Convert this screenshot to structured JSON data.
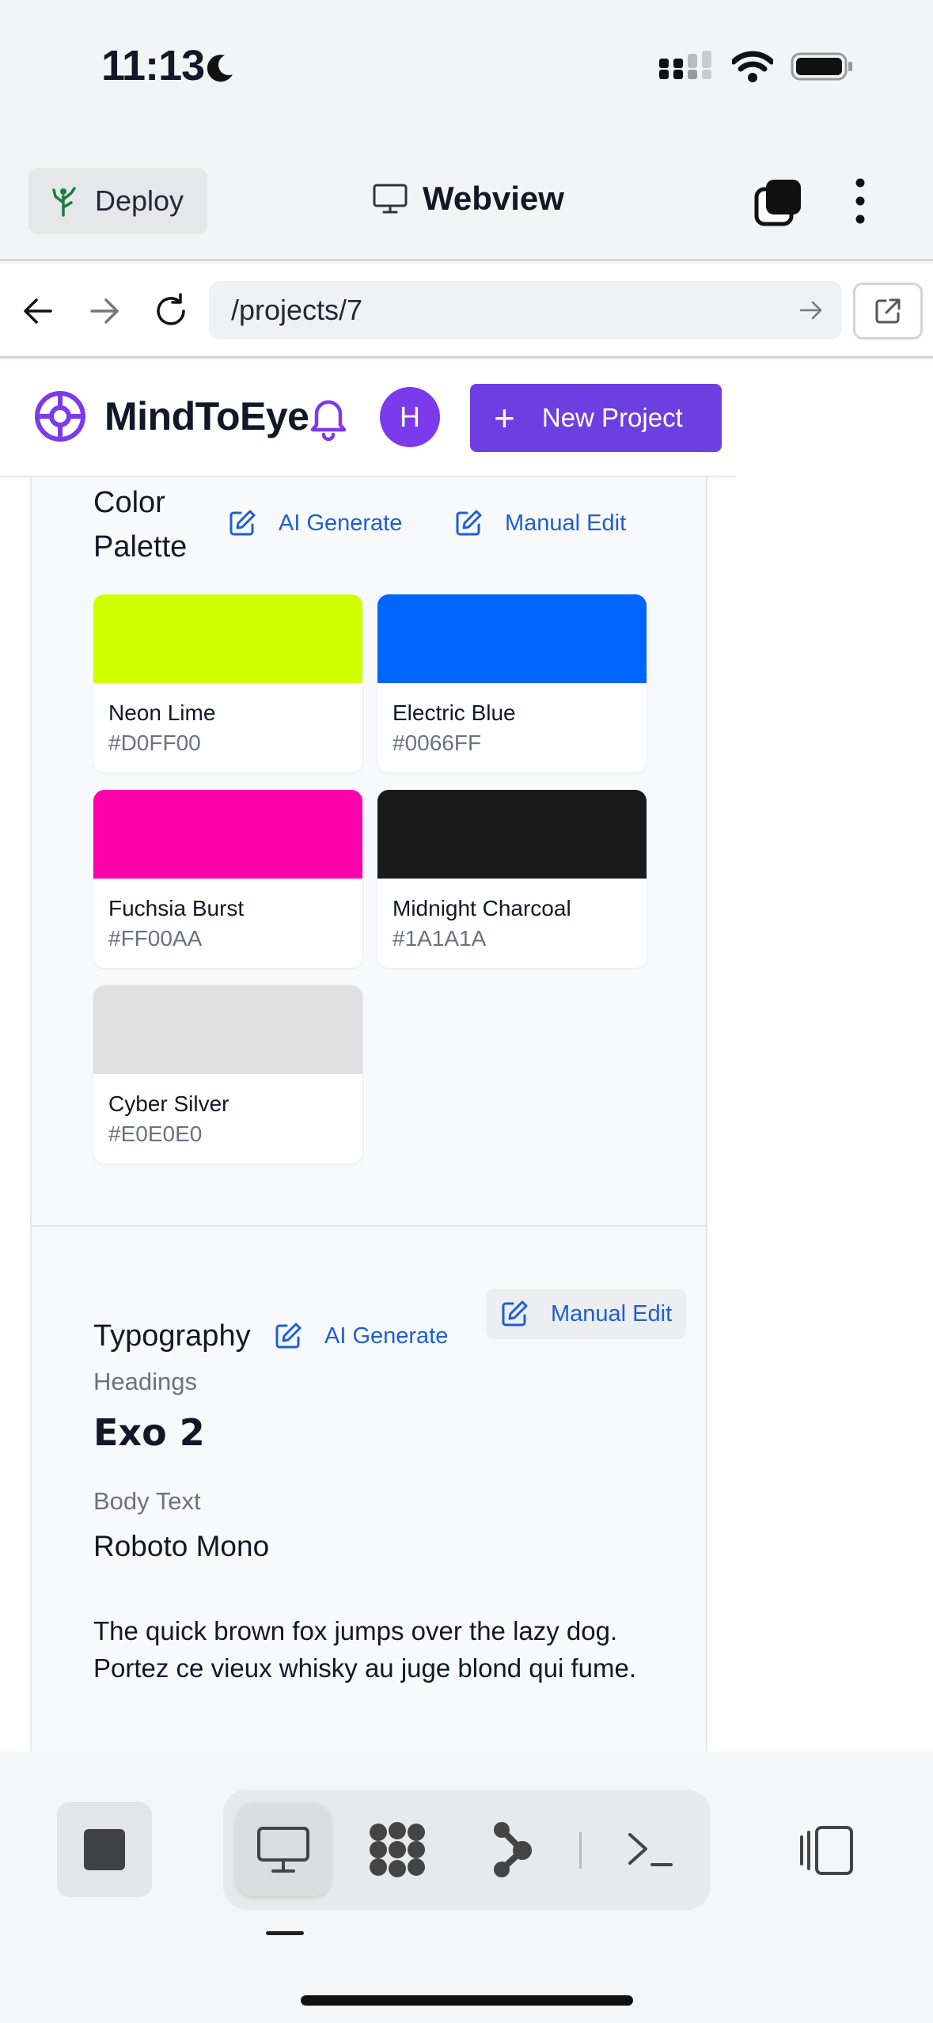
{
  "status_bar": {
    "time": "11:13"
  },
  "app_bar": {
    "deploy_label": "Deploy",
    "title": "Webview"
  },
  "url_bar": {
    "url": "/projects/7"
  },
  "site_header": {
    "brand": "MindToEye",
    "avatar_initial": "H",
    "new_project_label": "New Project"
  },
  "color_palette": {
    "title": "Color Palette",
    "ai_generate": "AI Generate",
    "manual_edit": "Manual Edit",
    "swatches": [
      {
        "name": "Neon Lime",
        "hex": "#D0FF00",
        "color": "#D0FF00"
      },
      {
        "name": "Electric Blue",
        "hex": "#0066FF",
        "color": "#0066FF"
      },
      {
        "name": "Fuchsia Burst",
        "hex": "#FF00AA",
        "color": "#FF00AA"
      },
      {
        "name": "Midnight Charcoal",
        "hex": "#1A1A1A",
        "color": "#1A1A1A"
      },
      {
        "name": "Cyber Silver",
        "hex": "#E0E0E0",
        "color": "#E0E0E0"
      }
    ]
  },
  "typography": {
    "title": "Typography",
    "ai_generate": "AI Generate",
    "manual_edit": "Manual Edit",
    "headings_label": "Headings",
    "headings_font": "Exo 2",
    "body_label": "Body Text",
    "body_font": "Roboto Mono",
    "sample_line1": "The quick brown fox jumps over the lazy dog.",
    "sample_line2": "Portez ce vieux whisky au juge blond qui fume."
  },
  "colors": {
    "accent": "#6D3FE0",
    "link": "#1D5FD4"
  },
  "icons": {
    "deploy": "deploy-tree-icon",
    "webview": "monitor-icon",
    "tabs": "tabs-icon",
    "more": "more-vertical-icon",
    "back": "arrow-left-icon",
    "forward": "arrow-right-icon",
    "reload": "reload-icon",
    "external": "external-link-icon",
    "bell": "bell-icon",
    "edit": "edit-icon",
    "toolbar": [
      "stop-icon",
      "monitor-icon",
      "grid-dots-icon",
      "graph-icon",
      "terminal-icon",
      "side-panel-icon"
    ]
  }
}
